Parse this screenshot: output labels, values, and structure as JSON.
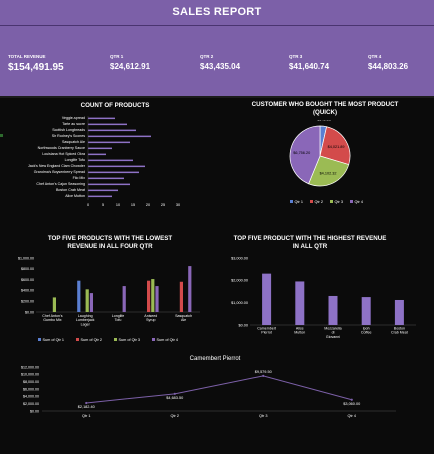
{
  "header": {
    "title": "SALES REPORT"
  },
  "kpis": [
    {
      "label": "TOTAL REVENUE",
      "value": "$154,491.95"
    },
    {
      "label": "QTR 1",
      "value": "$24,612.91"
    },
    {
      "label": "QTR 2",
      "value": "$43,435.04"
    },
    {
      "label": "QTR 3",
      "value": "$41,640.74"
    },
    {
      "label": "QTR 4",
      "value": "$44,803.26"
    }
  ],
  "colors": {
    "header_bg": "#7c60a8",
    "bar_purple": "#8e72c6",
    "q1": "#5b7fd2",
    "q2": "#d34b4b",
    "q3": "#9bbb54",
    "q4": "#8a67b8",
    "line": "#7c60a8"
  },
  "chart_data": [
    {
      "type": "bar",
      "orientation": "horizontal",
      "title": "COUNT OF PRODUCTS",
      "categories": [
        "Veggie-spread",
        "Tarte au sucre",
        "Scottish Longbreads",
        "Sir Rodney's Scones",
        "Sasquatch Ale",
        "Northwoods Cranberry Sauce",
        "Louisiana Hot Spiced Okra",
        "Longlife Tofu",
        "Jack's New England Clam Chowder",
        "Grandma's Boysenberry Spread",
        "Filo Mix",
        "Chef Anton's Cajun Seasoning",
        "Boston Crab Meat",
        "Alice Mutton"
      ],
      "values": [
        9,
        13,
        16,
        21,
        14,
        8,
        6,
        15,
        19,
        17,
        12,
        14,
        10,
        8
      ],
      "xticks": [
        "0",
        "5",
        "10",
        "15",
        "20",
        "25",
        "30"
      ],
      "xlim": [
        0,
        30
      ]
    },
    {
      "type": "pie",
      "title": "CUSTOMER WHO BOUGHT THE MOST PRODUCT (QUICK)",
      "categories": [
        "Qtr 1",
        "Qtr 2",
        "Qtr 3",
        "Qtr 4"
      ],
      "values": [
        543.56,
        4021.89,
        4102.32,
        6756.2
      ],
      "labels": [
        "$543.56",
        "$4,021.89",
        "$4,102.32",
        "$6,756.20"
      ],
      "legend": "bottom"
    },
    {
      "type": "bar",
      "title": "TOP FIVE PRODUCTS WITH THE LOWEST REVENUE IN ALL FOUR QTR",
      "categories": [
        "Chef Anton's Gumbo Mix",
        "Laughing Lumberjack Lager",
        "Longlife Tofu",
        "Aniseed Syrup",
        "Sasquatch Ale"
      ],
      "series": [
        {
          "name": "Sum of Qtr 1",
          "values": [
            0,
            0,
            0,
            0,
            0
          ]
        },
        {
          "name": "Sum of Qtr 2",
          "values": [
            0,
            0,
            0,
            580,
            560
          ]
        },
        {
          "name": "Sum of Qtr 3",
          "values": [
            270,
            420,
            0,
            0,
            0
          ]
        },
        {
          "name": "Sum of Qtr 4",
          "values": [
            0,
            350,
            480,
            480,
            850
          ]
        }
      ],
      "extra_bars": [
        {
          "category": 0,
          "series": 3,
          "value": 0
        },
        {
          "category": 1,
          "series": 0,
          "value": 580
        },
        {
          "category": 3,
          "series": 1,
          "value": 120
        },
        {
          "category": 3,
          "series": 2,
          "value": 610
        }
      ],
      "yticks": [
        "$0.00",
        "$200.00",
        "$400.00",
        "$600.00",
        "$800.00",
        "$1,000.00"
      ],
      "ylim": [
        0,
        1000
      ],
      "legend": "bottom"
    },
    {
      "type": "bar",
      "title": "TOP FIVE PRODUCT WITH THE HIGHEST REVENUE IN ALL QTR",
      "categories": [
        "Camembert Pierrot",
        "Alice Mutton",
        "Mozzarella di Giovanni",
        "Ipoh Coffee",
        "Boston Crab Meat"
      ],
      "values": [
        2300,
        1950,
        1300,
        1250,
        1120
      ],
      "yticks": [
        "$0.00",
        "$1,000.00",
        "$2,000.00",
        "$3,000.00"
      ],
      "ylim": [
        0,
        3000
      ]
    },
    {
      "type": "line",
      "title": "Camembert Pierrot",
      "categories": [
        "Qtr 1",
        "Qtr 2",
        "Qtr 3",
        "Qtr 4"
      ],
      "values": [
        2182.4,
        4683.5,
        9579.5,
        3060.0
      ],
      "labels": [
        "$2,182.40",
        "$4,683.50",
        "$9,579.50",
        "$3,060.00"
      ],
      "yticks": [
        "$0.00",
        "$2,000.00",
        "$4,000.00",
        "$6,000.00",
        "$8,000.00",
        "$10,000.00",
        "$12,000.00"
      ],
      "ylim": [
        0,
        12000
      ]
    }
  ]
}
